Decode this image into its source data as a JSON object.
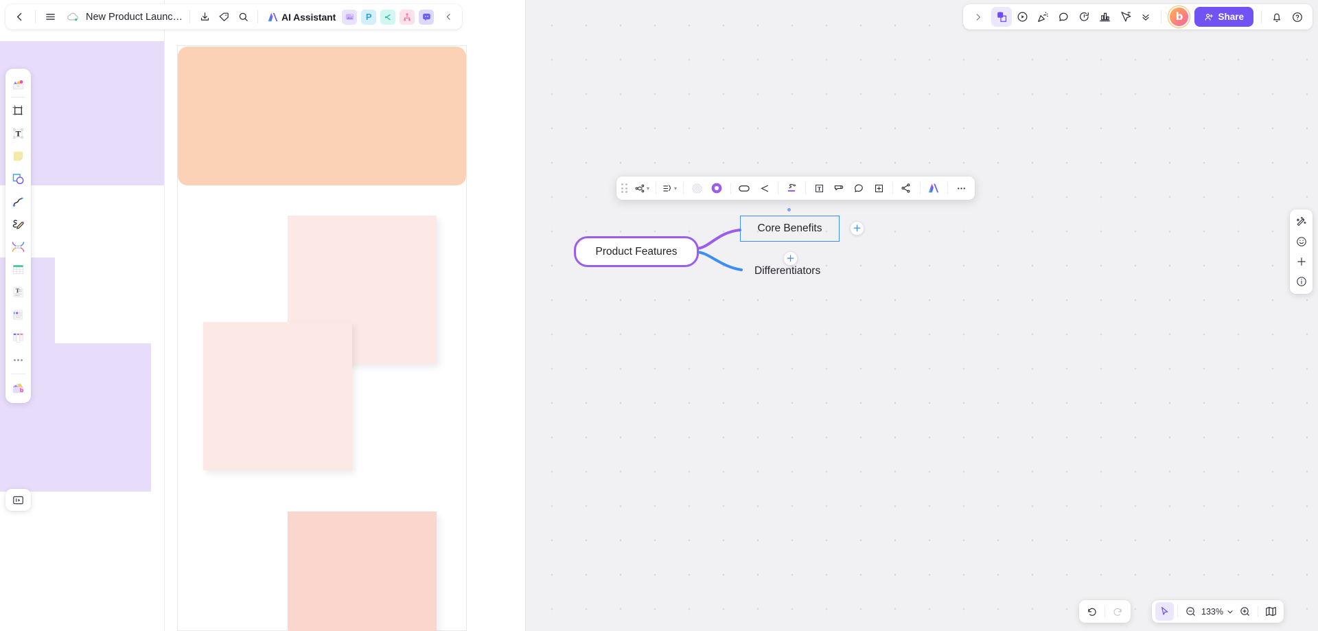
{
  "topbar": {
    "back_label": "back-navigation",
    "menu_label": "main-menu",
    "doc_title": "New Product Launch Pla...",
    "cloud_status": "synced",
    "download_label": "Download",
    "tag_label": "Tag",
    "search_label": "Search",
    "ai_assistant_label": "AI Assistant",
    "app_icons": [
      {
        "name": "image-app-icon",
        "glyph": "⛰",
        "bg": "#e5defb",
        "fg": "#9d7ef0"
      },
      {
        "name": "presentation-app-icon",
        "glyph": "P",
        "bg": "#d9f0fb",
        "fg": "#36a8dd"
      },
      {
        "name": "mindmap-app-icon",
        "glyph": "⑂",
        "bg": "#d4f5ef",
        "fg": "#2fb8a3"
      },
      {
        "name": "table-app-icon",
        "glyph": "⑂",
        "bg": "#fde0ea",
        "fg": "#f472a5"
      },
      {
        "name": "comment-app-icon",
        "glyph": "▣",
        "bg": "#e0def9",
        "fg": "#6d5ef0"
      }
    ],
    "collapse_label": "Collapse toolbar"
  },
  "topbar_right": {
    "expand_label": "Expand",
    "tools": [
      {
        "name": "sticker-tool-icon",
        "active": true
      },
      {
        "name": "present-tool-icon",
        "active": false
      },
      {
        "name": "celebrate-tool-icon",
        "active": false
      },
      {
        "name": "comment-tool-icon",
        "active": false
      },
      {
        "name": "timer-tool-icon",
        "active": false
      },
      {
        "name": "vote-tool-icon",
        "active": false
      },
      {
        "name": "cursor-share-tool-icon",
        "active": false
      }
    ],
    "more_label": "More tools",
    "avatar_initial": "b",
    "share_label": "Share",
    "notifications_label": "Notifications",
    "help_label": "Help"
  },
  "tool_rail": {
    "items": [
      {
        "name": "tool-template-library",
        "label": "Templates"
      },
      {
        "name": "tool-frame",
        "label": "Frame"
      },
      {
        "name": "tool-text",
        "label": "Text"
      },
      {
        "name": "tool-sticky-note",
        "label": "Sticky note"
      },
      {
        "name": "tool-shape",
        "label": "Shape"
      },
      {
        "name": "tool-connector",
        "label": "Connector line"
      },
      {
        "name": "tool-pen",
        "label": "Pen"
      },
      {
        "name": "tool-mindmap",
        "label": "Mind map"
      },
      {
        "name": "tool-table",
        "label": "Table"
      },
      {
        "name": "tool-note-doc",
        "label": "Document"
      },
      {
        "name": "tool-card",
        "label": "Card"
      },
      {
        "name": "tool-kanban",
        "label": "Kanban"
      },
      {
        "name": "tool-more",
        "label": "More"
      },
      {
        "name": "tool-ai-toolkit",
        "label": "AI toolkit"
      }
    ],
    "bottom_label": "Import / upload"
  },
  "element_toolbar": {
    "drag_label": "Drag toolbar",
    "items": [
      {
        "name": "mindmap-layout-button",
        "label": "Layout",
        "caret": "⌄"
      },
      {
        "name": "mindmap-structure-button",
        "label": "Structure",
        "caret": "⌄"
      },
      {
        "name": "fill-transparent-button",
        "label": "Transparent fill"
      },
      {
        "name": "fill-color-button",
        "label": "Fill color",
        "color": "#9b5cf0"
      },
      {
        "name": "shape-style-button",
        "label": "Shape style"
      },
      {
        "name": "line-style-button",
        "label": "Line style"
      },
      {
        "name": "highlight-color-button",
        "label": "Highlight color",
        "color": "#9b5cf0"
      },
      {
        "name": "text-style-button",
        "label": "Text style"
      },
      {
        "name": "sticky-convert-button",
        "label": "Convert to sticky"
      },
      {
        "name": "comment-button",
        "label": "Comment"
      },
      {
        "name": "add-node-button",
        "label": "Add node"
      },
      {
        "name": "connect-button",
        "label": "Connect"
      },
      {
        "name": "ai-button",
        "label": "AI"
      },
      {
        "name": "more-options-button",
        "label": "More"
      }
    ]
  },
  "mindmap": {
    "root": {
      "label": "Product Features",
      "border_color": "#9b5cf0"
    },
    "children": [
      {
        "label": "Core Benefits",
        "selected": true,
        "select_color": "#3a8ef6",
        "branch_color": "#9b5cf0"
      },
      {
        "label": "Differentiators",
        "selected": false,
        "branch_color": "#3a8ef6"
      }
    ],
    "add_child_label": "+"
  },
  "right_panel": {
    "items": [
      {
        "name": "magic-wand-icon",
        "label": "Magic"
      },
      {
        "name": "emoji-reaction-icon",
        "label": "Reactions"
      },
      {
        "name": "zoom-in-plus-icon",
        "label": "Add"
      },
      {
        "name": "info-icon",
        "label": "Info"
      }
    ]
  },
  "bottom_bar": {
    "undo_label": "Undo",
    "redo_label": "Redo",
    "select_tool_label": "Select",
    "zoom_out_label": "Zoom out",
    "zoom_value": "133%",
    "zoom_caret": "⌄",
    "zoom_in_label": "Zoom in",
    "minimap_label": "Minimap"
  },
  "canvas_objects": {
    "board_cards": [
      {
        "name": "orange-card",
        "color": "#fbd2b6"
      },
      {
        "name": "pink-sticky-1",
        "color": "#fce9e6"
      },
      {
        "name": "pink-sticky-2",
        "color": "#fce9e6"
      },
      {
        "name": "peach-sticky-3",
        "color": "#fbd6cd"
      }
    ],
    "lavender_blocks": [
      {
        "name": "lavender-block-1",
        "color": "#e8dcfb"
      },
      {
        "name": "lavender-block-2",
        "color": "#e8dcfb"
      },
      {
        "name": "lavender-block-3",
        "color": "#e8dcfb"
      }
    ]
  }
}
